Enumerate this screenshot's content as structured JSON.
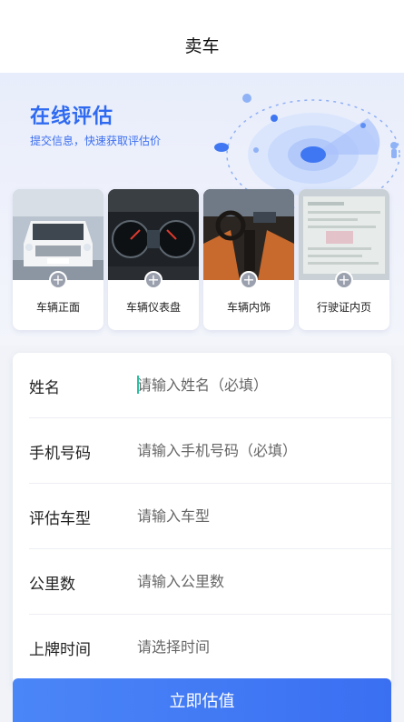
{
  "header": {
    "title": "卖车"
  },
  "banner": {
    "title": "在线评估",
    "subtitle": "提交信息，快速获取评估价"
  },
  "photos": [
    {
      "label": "车辆正面",
      "icon": "plus-icon"
    },
    {
      "label": "车辆仪表盘",
      "icon": "plus-icon"
    },
    {
      "label": "车辆内饰",
      "icon": "plus-icon"
    },
    {
      "label": "行驶证内页",
      "icon": "plus-icon"
    }
  ],
  "form": {
    "fields": [
      {
        "label": "姓名",
        "placeholder": "请输入姓名（必填）",
        "value": ""
      },
      {
        "label": "手机号码",
        "placeholder": "请输入手机号码（必填）",
        "value": ""
      },
      {
        "label": "评估车型",
        "placeholder": "请输入车型",
        "value": ""
      },
      {
        "label": "公里数",
        "placeholder": "请输入公里数",
        "value": ""
      },
      {
        "label": "上牌时间",
        "placeholder": "请选择时间",
        "value": ""
      }
    ]
  },
  "submit": {
    "label": "立即估值"
  },
  "colors": {
    "accent": "#2f6af0",
    "button": "#3a6ff2"
  }
}
